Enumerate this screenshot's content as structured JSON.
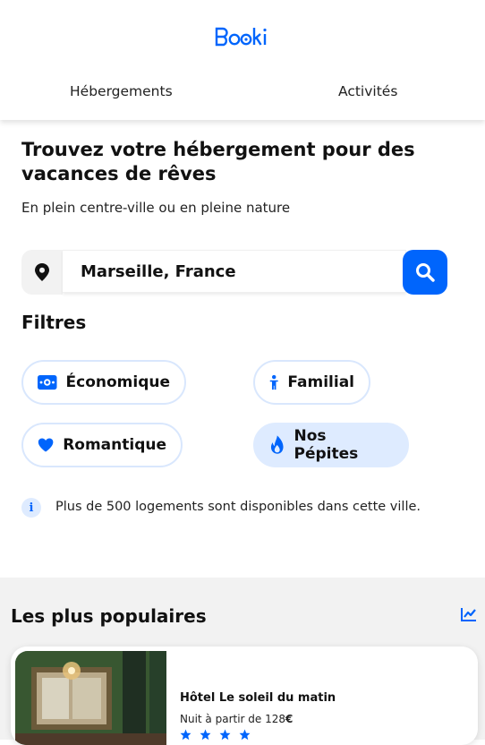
{
  "header": {
    "logo": "Booki",
    "nav": [
      {
        "label": "Hébergements"
      },
      {
        "label": "Activités"
      }
    ]
  },
  "hero": {
    "title": "Trouvez votre hébergement pour des vacances de rêves",
    "subtitle": "En plein centre-ville ou en pleine nature"
  },
  "search": {
    "value": "Marseille, France"
  },
  "filters": {
    "title": "Filtres",
    "items": [
      {
        "label": "Économique",
        "icon": "money-icon",
        "active": false
      },
      {
        "label": "Familial",
        "icon": "person-icon",
        "active": false
      },
      {
        "label": "Romantique",
        "icon": "heart-icon",
        "active": false
      },
      {
        "label": "Nos Pépites",
        "icon": "flame-icon",
        "active": true
      }
    ]
  },
  "info": {
    "text": "Plus de 500 logements sont disponibles dans cette ville."
  },
  "popular": {
    "title": "Les plus populaires",
    "cards": [
      {
        "name": "Hôtel Le soleil du matin",
        "price_prefix": "Nuit à partir de 128",
        "currency": "€",
        "stars": 4
      }
    ]
  },
  "colors": {
    "accent": "#0065fc",
    "chip_border": "#d9e7fd",
    "chip_active": "#deebff",
    "section_bg": "#f2f2f2"
  }
}
